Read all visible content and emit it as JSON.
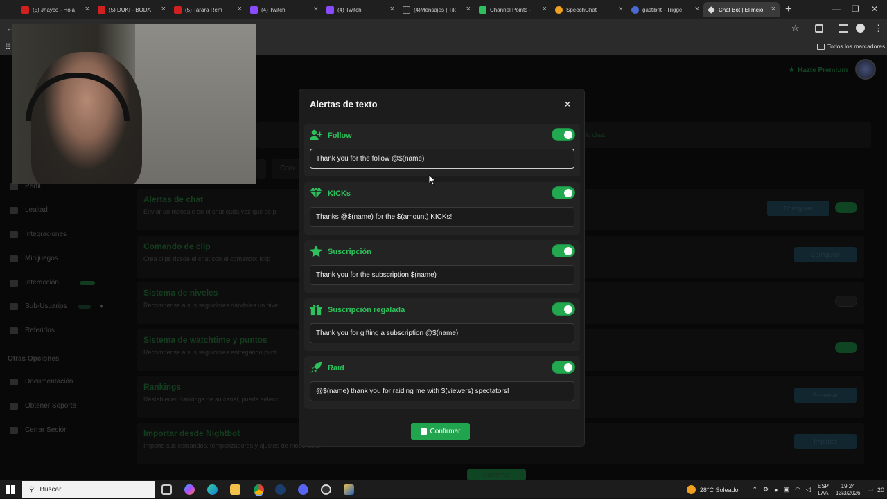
{
  "browser": {
    "tabs": [
      {
        "label": "(5) Jhayco - Hola",
        "color": "#d02020"
      },
      {
        "label": "(5) DUKI - BODA",
        "color": "#d02020"
      },
      {
        "label": "(5) Tarara Rem",
        "color": "#d02020"
      },
      {
        "label": "(4) Twitch",
        "color": "#8a4bff"
      },
      {
        "label": "(4) Twitch",
        "color": "#8a4bff"
      },
      {
        "label": "(4)Mensajes | Tik",
        "color": "#222222"
      },
      {
        "label": "Channel Points -",
        "color": "#2ec05c"
      },
      {
        "label": "SpeechChat",
        "color": "#f0a020"
      },
      {
        "label": "gastibnt - Trigge",
        "color": "#4a6ad0"
      },
      {
        "label": "Chat Bot | El mejo",
        "color": "#dddddd"
      }
    ],
    "bookmarks_label": "Todos los marcadores"
  },
  "page": {
    "premium_label": "Hazte Premium",
    "notice_text": "lo chat.",
    "sidebar": [
      {
        "label": "Perfil"
      },
      {
        "label": "Lealtad"
      },
      {
        "label": "Integraciones"
      },
      {
        "label": "Minijuegos"
      },
      {
        "label": "Interacción"
      },
      {
        "label": "Sub-Usuarios"
      },
      {
        "label": "Referidos"
      }
    ],
    "sidebar_section": "Otras Opciones",
    "sidebar_other": [
      {
        "label": "Documentación"
      },
      {
        "label": "Obtener Soporte"
      },
      {
        "label": "Cerrar Sesión"
      }
    ],
    "tab_label": "Com",
    "cards": [
      {
        "title": "Alertas de chat",
        "desc": "Enviar un mensaje en el chat cada vez que se p",
        "button": "Configurar"
      },
      {
        "title": "Comando de clip",
        "desc": "Crea clips desde el chat con el comando: !clip",
        "button": "Configurar"
      },
      {
        "title": "Sistema de niveles",
        "desc": "Recompense a sus seguidores dándoles un nive",
        "button": ""
      },
      {
        "title": "Sistema de watchtime y puntos",
        "desc": "Recompense a sus seguidores entregando punt",
        "button": ""
      },
      {
        "title": "Rankings",
        "desc": "Restablecer Rankings de su canal, puede selecc",
        "button": "Resetear"
      },
      {
        "title": "Importar desde Nightbot",
        "desc": "Importe sus comandos, temporizadores y ajustes de moderación",
        "button": "Importar"
      }
    ],
    "bottom_confirm": "Confirmar"
  },
  "modal": {
    "title": "Alertas de texto",
    "close": "×",
    "alerts": [
      {
        "label": "Follow",
        "icon": "user-plus-icon",
        "enabled": true,
        "value": "Thank you for the follow @$(name)"
      },
      {
        "label": "KICKs",
        "icon": "gem-icon",
        "enabled": true,
        "value": "Thanks @$(name) for the $(amount) KICKs!"
      },
      {
        "label": "Suscripción",
        "icon": "star-icon",
        "enabled": true,
        "value": "Thank you for the subscription $(name)"
      },
      {
        "label": "Suscripción regalada",
        "icon": "gift-icon",
        "enabled": true,
        "value": "Thank you for gifting a subscription @$(name)"
      },
      {
        "label": "Raid",
        "icon": "rocket-icon",
        "enabled": true,
        "value": "@$(name) thank you for raiding me with $(viewers) spectators!"
      }
    ],
    "confirm_label": "Confirmar",
    "accent": "#22a84f"
  },
  "taskbar": {
    "search_label": "Buscar",
    "weather": "28°C Soleado",
    "lang1": "ESP",
    "lang2": "LAA",
    "time": "19:24",
    "date": "13/3/2026",
    "notif_count": "20"
  }
}
